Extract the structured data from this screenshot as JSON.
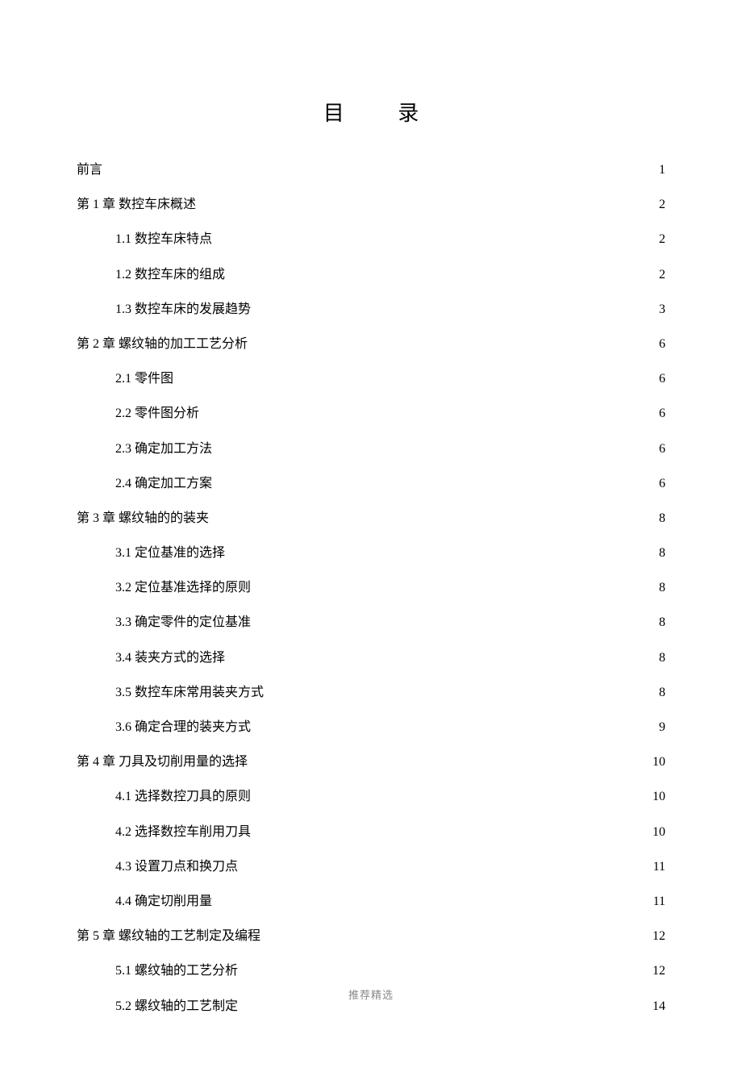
{
  "title": "目 录",
  "footer": "推荐精选",
  "toc": [
    {
      "label": "前言",
      "page": "1",
      "indent": false
    },
    {
      "label": "第 1 章 数控车床概述",
      "page": "2",
      "indent": false
    },
    {
      "label": "1.1 数控车床特点",
      "page": "2",
      "indent": true
    },
    {
      "label": "1.2 数控车床的组成",
      "page": "2",
      "indent": true
    },
    {
      "label": "1.3 数控车床的发展趋势",
      "page": "3",
      "indent": true
    },
    {
      "label": "第 2 章 螺纹轴的加工工艺分析",
      "page": "6",
      "indent": false
    },
    {
      "label": "2.1 零件图",
      "page": "6",
      "indent": true
    },
    {
      "label": "2.2 零件图分析",
      "page": "6",
      "indent": true
    },
    {
      "label": "2.3 确定加工方法",
      "page": "6",
      "indent": true
    },
    {
      "label": "2.4 确定加工方案",
      "page": "6",
      "indent": true
    },
    {
      "label": "第 3 章 螺纹轴的的装夹",
      "page": "8",
      "indent": false
    },
    {
      "label": "3.1 定位基准的选择",
      "page": "8",
      "indent": true
    },
    {
      "label": "3.2 定位基准选择的原则",
      "page": "8",
      "indent": true
    },
    {
      "label": "3.3 确定零件的定位基准",
      "page": "8",
      "indent": true
    },
    {
      "label": "3.4 装夹方式的选择",
      "page": "8",
      "indent": true
    },
    {
      "label": "3.5 数控车床常用装夹方式",
      "page": "8",
      "indent": true
    },
    {
      "label": "3.6 确定合理的装夹方式",
      "page": "9",
      "indent": true
    },
    {
      "label": "第 4 章 刀具及切削用量的选择",
      "page": "10",
      "indent": false
    },
    {
      "label": "4.1 选择数控刀具的原则",
      "page": "10",
      "indent": true
    },
    {
      "label": "4.2 选择数控车削用刀具",
      "page": "10",
      "indent": true
    },
    {
      "label": "4.3 设置刀点和换刀点",
      "page": "11",
      "indent": true
    },
    {
      "label": "4.4 确定切削用量",
      "page": "11",
      "indent": true
    },
    {
      "label": "第 5 章 螺纹轴的工艺制定及编程",
      "page": "12",
      "indent": false
    },
    {
      "label": "5.1 螺纹轴的工艺分析",
      "page": "12",
      "indent": true
    },
    {
      "label": "5.2 螺纹轴的工艺制定",
      "page": "14",
      "indent": true
    }
  ]
}
